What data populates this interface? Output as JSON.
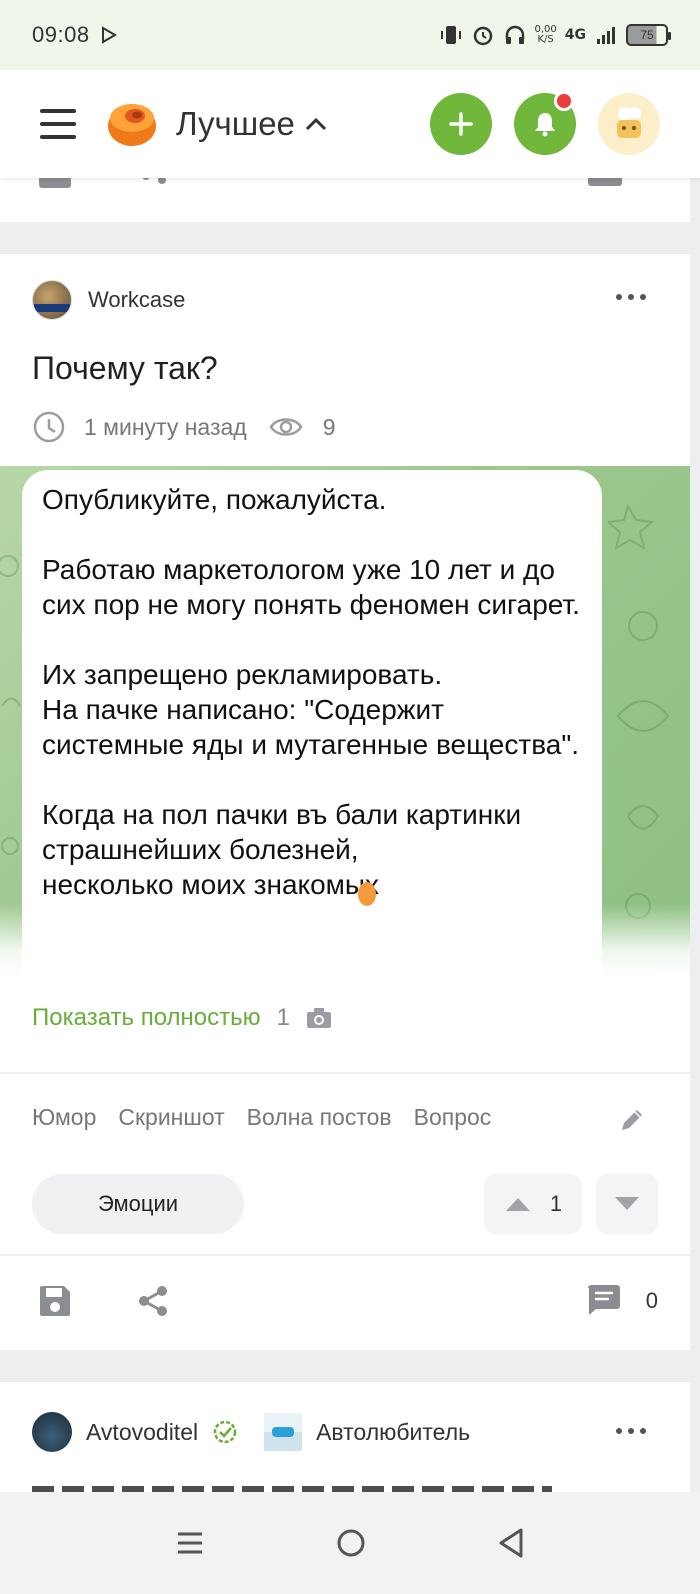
{
  "status_bar": {
    "time": "09:08",
    "net_speed_value": "0,00",
    "net_speed_unit": "K/S",
    "network": "4G",
    "battery": "75"
  },
  "header": {
    "title": "Лучшее",
    "accent_color": "#71b73b",
    "notification_dot_color": "#ee3b3b"
  },
  "post": {
    "author": "Workcase",
    "title": "Почему так?",
    "time_ago": "1 минуту назад",
    "views": "9",
    "image_text": "Опубликуйте, пожалуйста.\n\nРаботаю маркетологом уже 10 лет и до сих пор не могу понять феномен сигарет.\n\nИх запрещено рекламировать.\nНа пачке написано: \"Содержит системные яды и мутагенные вещества\".\n\nКогда на пол пачки въ бали картинки страшнейших болезней,\nнесколько моих знакомых",
    "show_full_label": "Показать полностью",
    "photo_count": "1",
    "tags": [
      "Юмор",
      "Скриншот",
      "Волна постов",
      "Вопрос"
    ],
    "emotions_label": "Эмоции",
    "rating": "1",
    "comments_count": "0"
  },
  "next_post": {
    "author": "Avtovoditel",
    "community": "Автолюбитель"
  },
  "icons": {
    "status": [
      "vibrate-icon",
      "alarm-icon",
      "headphones-icon",
      "signal-icon",
      "battery-icon"
    ],
    "header": [
      "menu-icon",
      "pikabu-logo",
      "chevron-up-icon",
      "plus-icon",
      "bell-icon",
      "avatar"
    ],
    "post": [
      "clock-icon",
      "eye-icon",
      "camera-icon",
      "pencil-icon",
      "arrow-up-icon",
      "arrow-down-icon",
      "save-icon",
      "share-icon",
      "comment-icon"
    ],
    "nav": [
      "recent-apps-icon",
      "home-icon",
      "back-icon"
    ]
  }
}
